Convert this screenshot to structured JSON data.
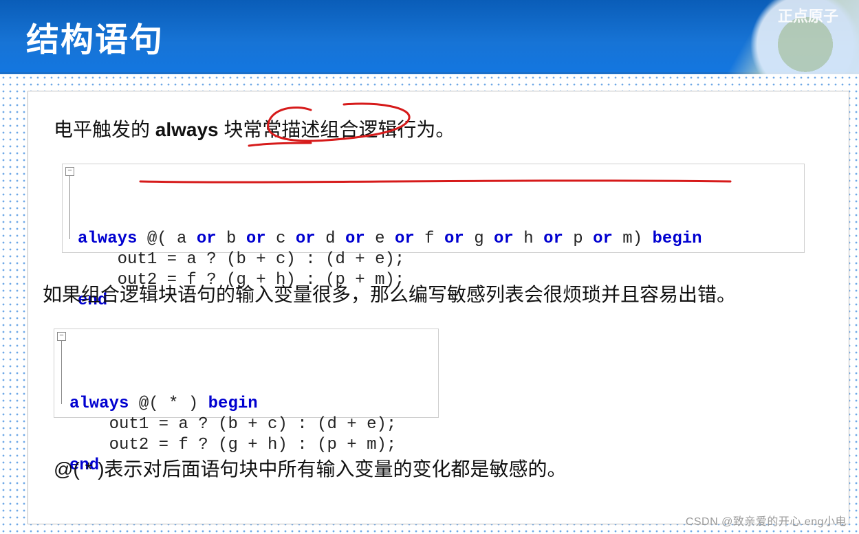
{
  "banner": {
    "title": "结构语句",
    "brand": "正点原子"
  },
  "para1_pre": "电平触发的 ",
  "para1_bold": "always",
  "para1_post": " 块常常描述组合逻辑行为。",
  "code1": {
    "l1a": "always",
    "l1b": " @( a ",
    "l1c": "or",
    "l1d": " b ",
    "l1e": "or",
    "l1f": " c ",
    "l1g": "or",
    "l1h": " d ",
    "l1i": "or",
    "l1j": " e ",
    "l1k": "or",
    "l1l": " f ",
    "l1m": "or",
    "l1n": " g ",
    "l1o": "or",
    "l1p": " h ",
    "l1q": "or",
    "l1r": " p ",
    "l1s": "or",
    "l1t": " m) ",
    "l1u": "begin",
    "l2": "    out1 = a ? (b + c) : (d + e);",
    "l3": "    out2 = f ? (g + h) : (p + m);",
    "l4": "end"
  },
  "para2": "如果组合逻辑块语句的输入变量很多，那么编写敏感列表会很烦琐并且容易出错。",
  "code2": {
    "l1a": "always",
    "l1b": " @( * ) ",
    "l1c": "begin",
    "l2": "    out1 = a ? (b + c) : (d + e);",
    "l3": "    out2 = f ? (g + h) : (p + m);",
    "l4": "end"
  },
  "para3": "@( * )表示对后面语句块中所有输入变量的变化都是敏感的。",
  "watermark": "CSDN @致亲爱的开心.eng小电"
}
